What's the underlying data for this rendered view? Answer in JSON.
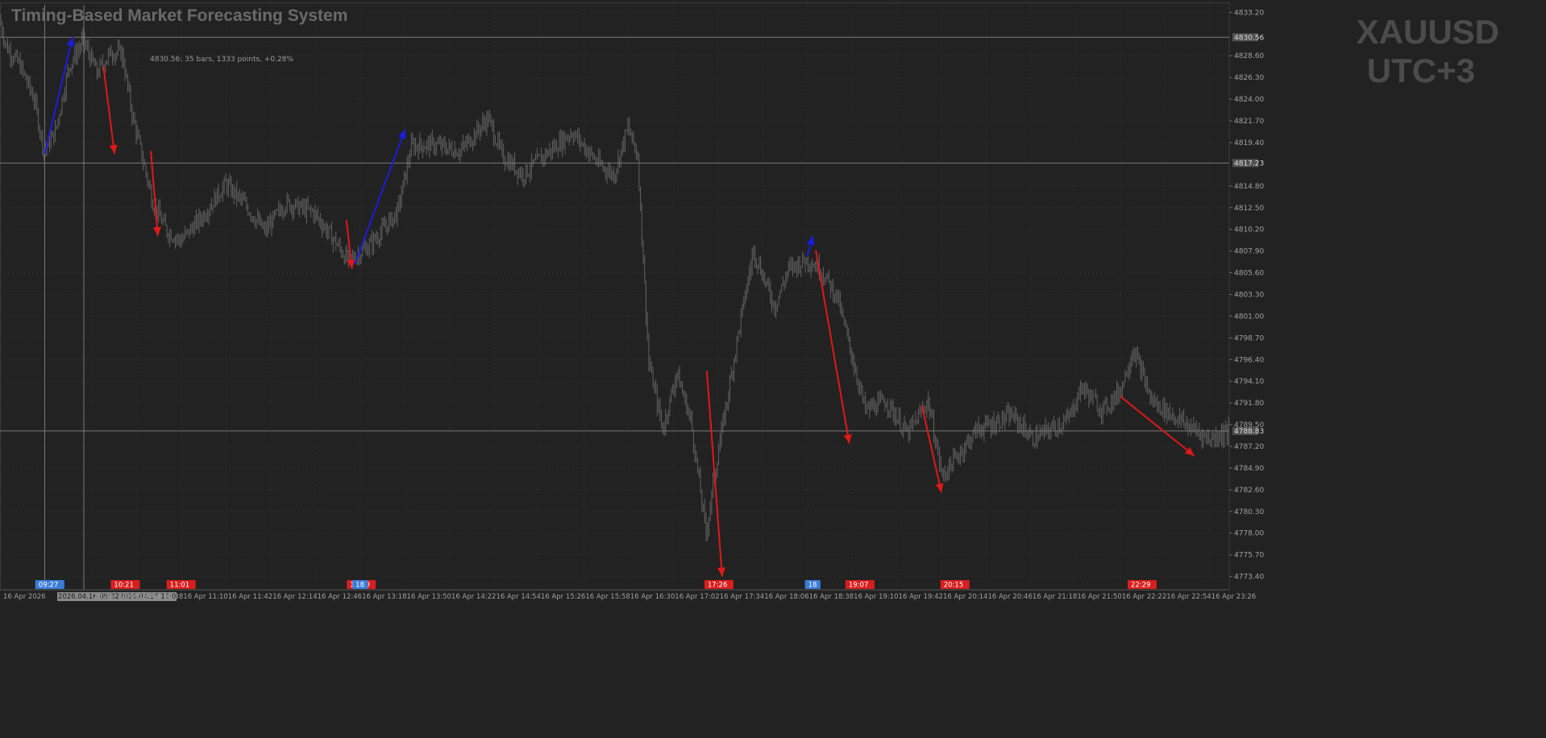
{
  "window": {
    "title": "Timing-Based Market Forecasting System",
    "symbol": "XAUUSD",
    "timezone": "UTC+3"
  },
  "measure_tooltip": "4830.56: 35 bars, 1333 points, +0.28%",
  "colors": {
    "background": "#222222",
    "grid": "#2c2c2c",
    "candles": "#626262",
    "arrow_up": "#1c1cdc",
    "arrow_down": "#e01818",
    "label_blue": "#3a7dd8",
    "label_red": "#d81e1e",
    "crosshair": "#7a7a7a",
    "axis_text": "#a0a0a0"
  },
  "price_axis": {
    "ticks": [
      "4833.20",
      "4830.56",
      "4828.60",
      "4826.30",
      "4824.00",
      "4821.70",
      "4819.40",
      "4817.23",
      "4814.80",
      "4812.50",
      "4810.20",
      "4807.90",
      "4805.60",
      "4803.30",
      "4801.00",
      "4798.70",
      "4796.40",
      "4794.10",
      "4791.80",
      "4789.50",
      "4788.83",
      "4787.20",
      "4784.90",
      "4782.60",
      "4780.30",
      "4778.00",
      "4775.70",
      "4773.40"
    ],
    "highlighted": [
      "4830.56",
      "4817.23",
      "4788.83"
    ]
  },
  "time_axis": {
    "labels": [
      "16 Apr 2026",
      "2026.04.16 09:32",
      "2026.04.16 10:00",
      "16 Apr 10:06",
      "16 Apr 10:38",
      "16 Apr 11:10",
      "16 Apr 11:42",
      "16 Apr 12:14",
      "16 Apr 12:46",
      "16 Apr 13:18",
      "16 Apr 13:50",
      "16 Apr 14:22",
      "16 Apr 14:54",
      "16 Apr 15:26",
      "16 Apr 15:58",
      "16 Apr 16:30",
      "16 Apr 17:02",
      "16 Apr 17:34",
      "16 Apr 18:06",
      "16 Apr 18:38",
      "16 Apr 19:10",
      "16 Apr 19:42",
      "16 Apr 20:14",
      "16 Apr 20:46",
      "16 Apr 21:18",
      "16 Apr 21:50",
      "16 Apr 22:22",
      "16 Apr 22:54",
      "16 Apr 23:26"
    ]
  },
  "time_markers": [
    {
      "text": "09:27",
      "color": "blue"
    },
    {
      "text": "10:21",
      "color": "red"
    },
    {
      "text": "11:01",
      "color": "red"
    },
    {
      "text": "13:10",
      "color": "red"
    },
    {
      "text": "18",
      "color": "blue"
    },
    {
      "text": "17:26",
      "color": "red"
    },
    {
      "text": "18",
      "color": "blue"
    },
    {
      "text": "19:07",
      "color": "red"
    },
    {
      "text": "20:15",
      "color": "red"
    },
    {
      "text": "22:29",
      "color": "red"
    }
  ],
  "chart_data": {
    "type": "candlestick",
    "title": "Timing-Based Market Forecasting System",
    "ylim": [
      4772.0,
      4834.0
    ],
    "xlim": [
      "16 Apr 2026 09:00",
      "16 Apr 2026 23:40"
    ],
    "horizontal_lines": [
      4830.56,
      4817.23,
      4788.83
    ],
    "vertical_lines": [
      "09:32",
      "10:00"
    ],
    "price_path": [
      [
        "09:00",
        4832.5
      ],
      [
        "09:05",
        4829.6
      ],
      [
        "09:15",
        4827.5
      ],
      [
        "09:25",
        4824.0
      ],
      [
        "09:32",
        4818.5
      ],
      [
        "09:40",
        4820.5
      ],
      [
        "09:50",
        4827.5
      ],
      [
        "10:00",
        4830.2
      ],
      [
        "10:10",
        4826.8
      ],
      [
        "10:20",
        4829.0
      ],
      [
        "10:28",
        4828.8
      ],
      [
        "10:35",
        4822.5
      ],
      [
        "10:50",
        4813.0
      ],
      [
        "11:00",
        4810.0
      ],
      [
        "11:10",
        4809.0
      ],
      [
        "11:25",
        4811.5
      ],
      [
        "11:42",
        4815.0
      ],
      [
        "11:55",
        4813.0
      ],
      [
        "12:10",
        4810.0
      ],
      [
        "12:25",
        4813.0
      ],
      [
        "12:45",
        4812.0
      ],
      [
        "13:00",
        4809.0
      ],
      [
        "13:10",
        4806.8
      ],
      [
        "13:25",
        4808.5
      ],
      [
        "13:45",
        4812.0
      ],
      [
        "13:55",
        4819.0
      ],
      [
        "14:10",
        4819.2
      ],
      [
        "14:30",
        4818.5
      ],
      [
        "14:50",
        4822.0
      ],
      [
        "15:00",
        4818.0
      ],
      [
        "15:15",
        4816.0
      ],
      [
        "15:30",
        4818.0
      ],
      [
        "15:50",
        4820.5
      ],
      [
        "16:10",
        4817.0
      ],
      [
        "16:20",
        4816.0
      ],
      [
        "16:30",
        4821.0
      ],
      [
        "16:37",
        4818.0
      ],
      [
        "16:45",
        4796.0
      ],
      [
        "16:55",
        4789.0
      ],
      [
        "17:05",
        4795.0
      ],
      [
        "17:15",
        4790.0
      ],
      [
        "17:26",
        4778.0
      ],
      [
        "17:34",
        4786.0
      ],
      [
        "17:50",
        4800.0
      ],
      [
        "18:00",
        4808.0
      ],
      [
        "18:15",
        4802.0
      ],
      [
        "18:25",
        4806.0
      ],
      [
        "18:38",
        4807.0
      ],
      [
        "18:48",
        4806.0
      ],
      [
        "19:00",
        4803.0
      ],
      [
        "19:10",
        4797.0
      ],
      [
        "19:20",
        4791.0
      ],
      [
        "19:35",
        4792.0
      ],
      [
        "19:50",
        4788.5
      ],
      [
        "20:05",
        4792.0
      ],
      [
        "20:15",
        4784.0
      ],
      [
        "20:25",
        4786.0
      ],
      [
        "20:40",
        4789.0
      ],
      [
        "20:50",
        4789.5
      ],
      [
        "21:05",
        4790.5
      ],
      [
        "21:20",
        4788.0
      ],
      [
        "21:45",
        4790.0
      ],
      [
        "21:55",
        4793.5
      ],
      [
        "22:10",
        4791.0
      ],
      [
        "22:22",
        4793.0
      ],
      [
        "22:32",
        4797.5
      ],
      [
        "22:45",
        4792.0
      ],
      [
        "23:00",
        4790.5
      ],
      [
        "23:15",
        4789.0
      ],
      [
        "23:26",
        4788.0
      ],
      [
        "23:40",
        4788.8
      ]
    ],
    "forecast_arrows": [
      {
        "direction": "up",
        "from": [
          "09:32",
          4818.2
        ],
        "to": [
          "09:52",
          4830.6
        ]
      },
      {
        "direction": "down",
        "from": [
          "10:14",
          4827.5
        ],
        "to": [
          "10:22",
          4818.2
        ]
      },
      {
        "direction": "down",
        "from": [
          "10:48",
          4818.5
        ],
        "to": [
          "10:53",
          4809.5
        ]
      },
      {
        "direction": "down",
        "from": [
          "13:08",
          4811.2
        ],
        "to": [
          "13:12",
          4806.0
        ]
      },
      {
        "direction": "up",
        "from": [
          "13:14",
          4806.5
        ],
        "to": [
          "13:50",
          4820.8
        ]
      },
      {
        "direction": "down",
        "from": [
          "17:26",
          4795.2
        ],
        "to": [
          "17:37",
          4773.4
        ]
      },
      {
        "direction": "up",
        "from": [
          "18:38",
          4807.4
        ],
        "to": [
          "18:42",
          4809.5
        ]
      },
      {
        "direction": "down",
        "from": [
          "18:44",
          4808.0
        ],
        "to": [
          "19:08",
          4787.5
        ]
      },
      {
        "direction": "down",
        "from": [
          "20:00",
          4791.5
        ],
        "to": [
          "20:14",
          4782.3
        ]
      },
      {
        "direction": "down",
        "from": [
          "22:22",
          4792.5
        ],
        "to": [
          "23:15",
          4786.2
        ]
      }
    ]
  }
}
